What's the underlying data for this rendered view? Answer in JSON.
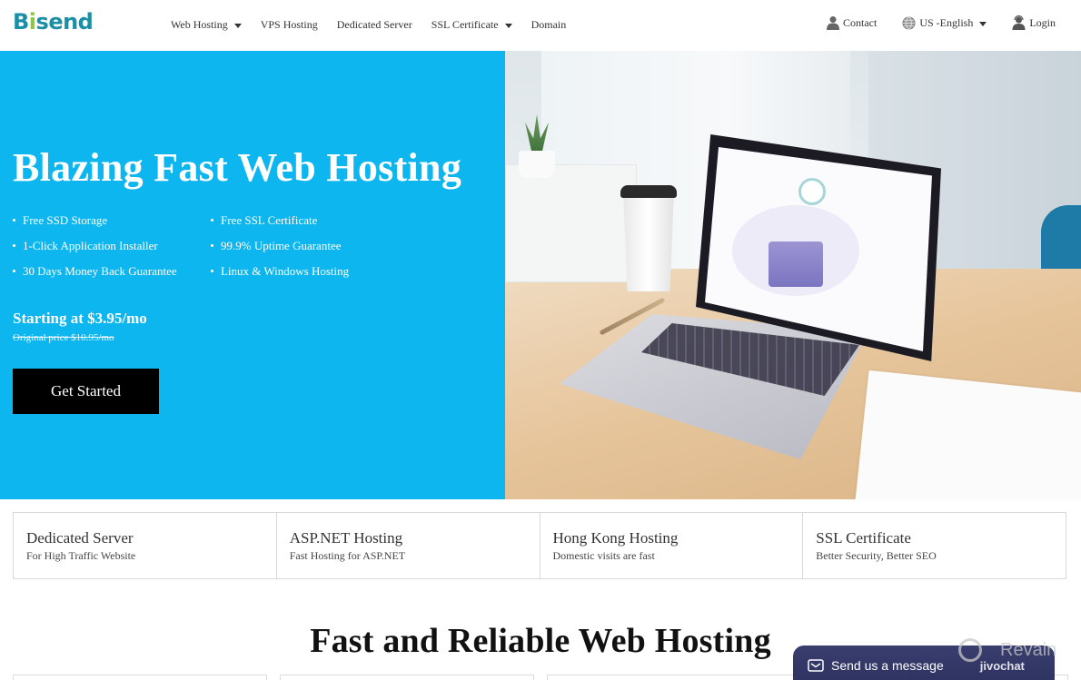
{
  "header": {
    "logo": {
      "text_pre": "B",
      "text_dot_char": "i",
      "text_post": "send"
    },
    "nav": [
      {
        "label": "Web Hosting",
        "has_dropdown": true
      },
      {
        "label": "VPS Hosting",
        "has_dropdown": false
      },
      {
        "label": "Dedicated Server",
        "has_dropdown": false
      },
      {
        "label": "SSL Certificate",
        "has_dropdown": true
      },
      {
        "label": "Domain",
        "has_dropdown": false
      }
    ],
    "right": {
      "contact": {
        "label": "Contact",
        "icon": "user-icon"
      },
      "language": {
        "label": "US -English",
        "icon": "globe-icon"
      },
      "login": {
        "label": "Login",
        "icon": "support-agent-icon"
      }
    }
  },
  "hero": {
    "title": "Blazing Fast Web Hosting",
    "features_left": [
      "Free SSD Storage",
      "1-Click Application Installer",
      "30 Days Money Back Guarantee"
    ],
    "features_right": [
      "Free SSL Certificate",
      "99.9% Uptime Guarantee",
      "Linux & Windows Hosting"
    ],
    "price": "Starting at $3.95/mo",
    "original_price": "Original price $10.95/mo",
    "cta_label": "Get Started",
    "accent_color": "#0db6ee",
    "image": "laptop-on-desk-photo"
  },
  "services": [
    {
      "title": "Dedicated Server",
      "subtitle": "For High Traffic Website"
    },
    {
      "title": "ASP.NET Hosting",
      "subtitle": "Fast Hosting for ASP.NET"
    },
    {
      "title": "Hong Kong Hosting",
      "subtitle": "Domestic visits are fast"
    },
    {
      "title": "SSL Certificate",
      "subtitle": "Better Security, Better SEO"
    }
  ],
  "section": {
    "title": "Fast and Reliable Web Hosting"
  },
  "chat": {
    "label": "Send us a message",
    "brand": "jivochat",
    "icon": "envelope-icon"
  },
  "watermark": {
    "text": "Revain"
  }
}
